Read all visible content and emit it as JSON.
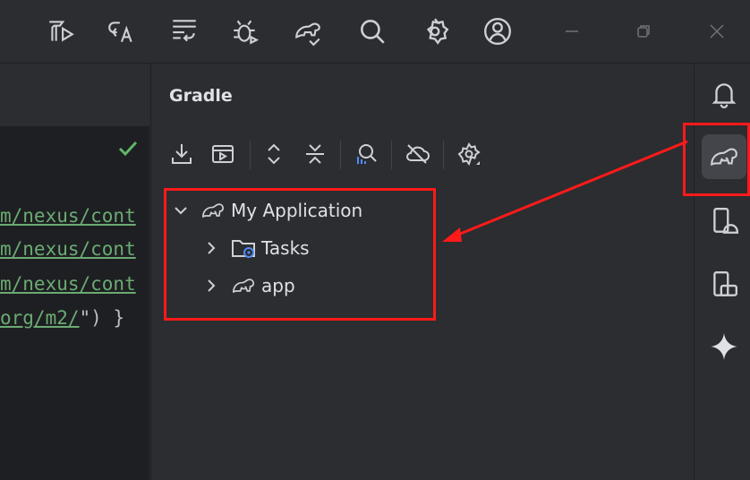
{
  "titlebar": {
    "icons": [
      "build-run-icon",
      "translate-icon",
      "format-icon",
      "debug-icon",
      "gradle-sync-icon",
      "search-icon",
      "settings-icon",
      "account-icon"
    ],
    "window_controls": [
      "minimize",
      "restore",
      "close"
    ]
  },
  "editor": {
    "lines": [
      {
        "link": "m/nexus/cont",
        "rest": ""
      },
      {
        "link": "m/nexus/cont",
        "rest": ""
      },
      {
        "link": "m/nexus/cont",
        "rest": ""
      },
      {
        "link": "org/m2/",
        "rest": "\") }"
      }
    ],
    "status_check": "✓"
  },
  "gradle": {
    "title": "Gradle",
    "toolbar": [
      "download-icon",
      "run-config-icon",
      "expand-all-icon",
      "collapse-all-icon",
      "analyze-icon",
      "offline-icon",
      "settings-icon"
    ],
    "tree": [
      {
        "label": "My Application",
        "level": 0,
        "expanded": true,
        "icon": "gradle-elephant-icon"
      },
      {
        "label": "Tasks",
        "level": 1,
        "expanded": false,
        "icon": "folder-settings-icon"
      },
      {
        "label": "app",
        "level": 1,
        "expanded": false,
        "icon": "gradle-elephant-icon"
      }
    ]
  },
  "right_stripe": {
    "items": [
      "notifications-icon",
      "gradle-icon",
      "device-manager-icon",
      "running-devices-icon",
      "gemini-icon"
    ],
    "active": "gradle-icon"
  },
  "colors": {
    "highlight": "#ff1a1a",
    "link_green": "#6aab73",
    "panel_bg": "#2b2d30",
    "editor_bg": "#1e1f22"
  }
}
